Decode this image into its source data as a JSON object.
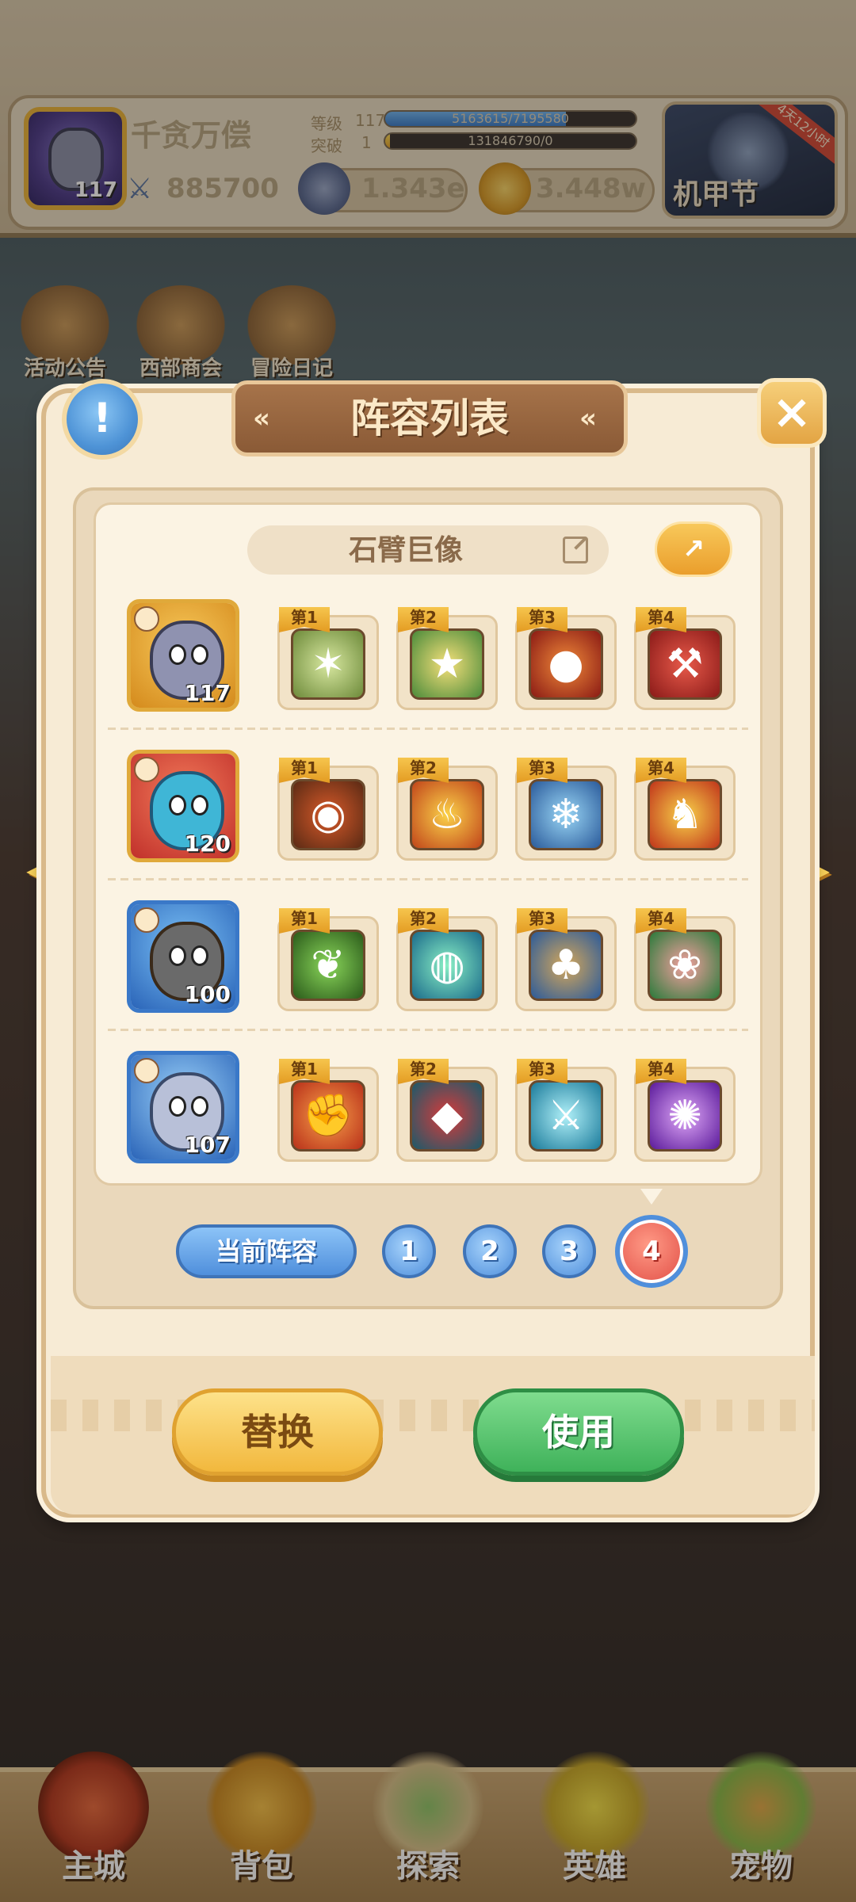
{
  "header": {
    "player_name": "千贪万偿",
    "avatar_level": "117",
    "power": "885700",
    "level_label": "等级",
    "level_value": "117",
    "level_progress_text": "5163615/7195580",
    "level_progress": 0.72,
    "breakthrough_label": "突破",
    "breakthrough_value": "1",
    "breakthrough_progress_text": "131846790/0",
    "breakthrough_progress": 0.02,
    "currency_1": "1.343e",
    "currency_2": "3.448w",
    "event_title": "机甲节",
    "event_ribbon": "4天12小时"
  },
  "side_menu": [
    {
      "label": "活动公告"
    },
    {
      "label": "西部商会"
    },
    {
      "label": "冒险日记"
    }
  ],
  "modal": {
    "title": "阵容列表",
    "lineup_name": "石臂巨像",
    "current_label": "当前阵容",
    "tabs": [
      "1",
      "2",
      "3",
      "4"
    ],
    "active_tab": "4",
    "replace_label": "替换",
    "use_label": "使用",
    "rows": [
      {
        "hero_level": "117",
        "slots": [
          {
            "tag": "第1",
            "icon": "spiked-mace-icon"
          },
          {
            "tag": "第2",
            "icon": "star-shield-icon"
          },
          {
            "tag": "第3",
            "icon": "fire-demon-face-icon"
          },
          {
            "tag": "第4",
            "icon": "red-battle-axe-icon"
          }
        ]
      },
      {
        "hero_level": "120",
        "slots": [
          {
            "tag": "第1",
            "icon": "red-eye-helmet-icon"
          },
          {
            "tag": "第2",
            "icon": "fire-brazier-icon"
          },
          {
            "tag": "第3",
            "icon": "ice-beast-icon"
          },
          {
            "tag": "第4",
            "icon": "fire-dragon-icon"
          }
        ]
      },
      {
        "hero_level": "100",
        "slots": [
          {
            "tag": "第1",
            "icon": "thorn-vines-icon"
          },
          {
            "tag": "第2",
            "icon": "green-orb-icon"
          },
          {
            "tag": "第3",
            "icon": "tree-golem-icon"
          },
          {
            "tag": "第4",
            "icon": "peach-sprout-icon"
          }
        ]
      },
      {
        "hero_level": "107",
        "slots": [
          {
            "tag": "第1",
            "icon": "flaming-fist-icon"
          },
          {
            "tag": "第2",
            "icon": "red-mask-icon"
          },
          {
            "tag": "第3",
            "icon": "ice-trident-icon"
          },
          {
            "tag": "第4",
            "icon": "purple-rune-icon"
          }
        ]
      }
    ]
  },
  "bottom_nav": [
    {
      "label": "主城",
      "active": true
    },
    {
      "label": "背包",
      "active": false
    },
    {
      "label": "探索",
      "active": false
    },
    {
      "label": "英雄",
      "active": false
    },
    {
      "label": "宠物",
      "active": false
    }
  ],
  "colors": {
    "accent_gold": "#e3a443",
    "panel_bg": "#f7ebd5",
    "title_plate": "#8a5a36",
    "tab_blue": "#4f8fdc",
    "tab_active_red": "#e04b43",
    "use_green": "#3fb25a",
    "replace_yellow": "#f2b83d"
  }
}
